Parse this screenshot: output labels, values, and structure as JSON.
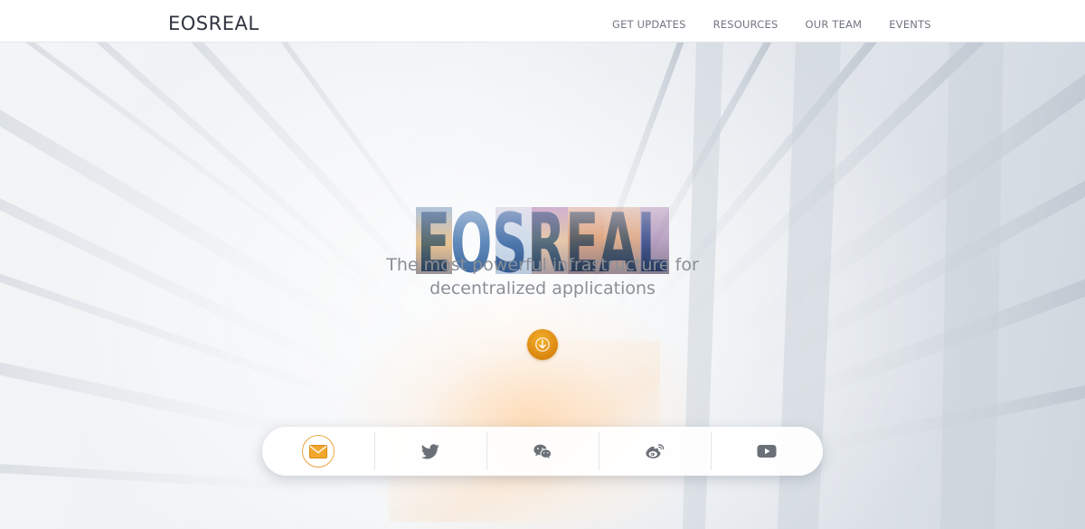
{
  "header": {
    "brand": "EOSREAL",
    "nav": [
      {
        "label": "GET UPDATES"
      },
      {
        "label": "RESOURCES"
      },
      {
        "label": "OUR TEAM"
      },
      {
        "label": "EVENTS"
      }
    ]
  },
  "hero": {
    "logo_text": "EOSREAL",
    "tagline_line1": "The most powerful infrastructure for",
    "tagline_line2": "decentralized applications",
    "scroll_icon": "arrow-down-icon"
  },
  "social": [
    {
      "icon": "mail-icon"
    },
    {
      "icon": "twitter-icon"
    },
    {
      "icon": "wechat-icon"
    },
    {
      "icon": "weibo-icon"
    },
    {
      "icon": "youtube-icon"
    }
  ],
  "colors": {
    "accent": "#e59a1f",
    "brand_text": "#2f3440",
    "nav_text": "#707680",
    "tagline": "#8a8f97",
    "social_icon": "#6b7078"
  }
}
